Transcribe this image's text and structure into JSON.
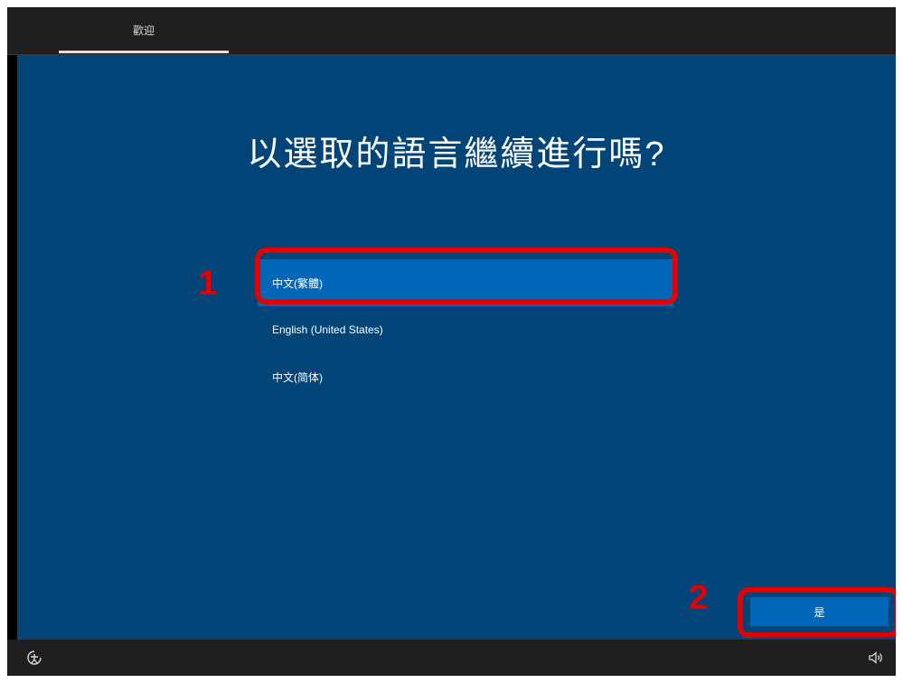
{
  "header": {
    "tab_label": "歡迎"
  },
  "main": {
    "title": "以選取的語言繼續進行嗎?",
    "languages": [
      {
        "label": "中文(繁體)",
        "selected": true
      },
      {
        "label": "English (United States)",
        "selected": false
      },
      {
        "label": "中文(简体)",
        "selected": false
      }
    ],
    "yes_button": "是"
  },
  "annotations": {
    "step_1": "1",
    "step_2": "2"
  },
  "footer": {
    "left_icon": "ease-of-access-icon",
    "right_icon": "volume-icon"
  },
  "colors": {
    "background": "#004478",
    "accent": "#0067b8",
    "highlight": "#e00000"
  }
}
